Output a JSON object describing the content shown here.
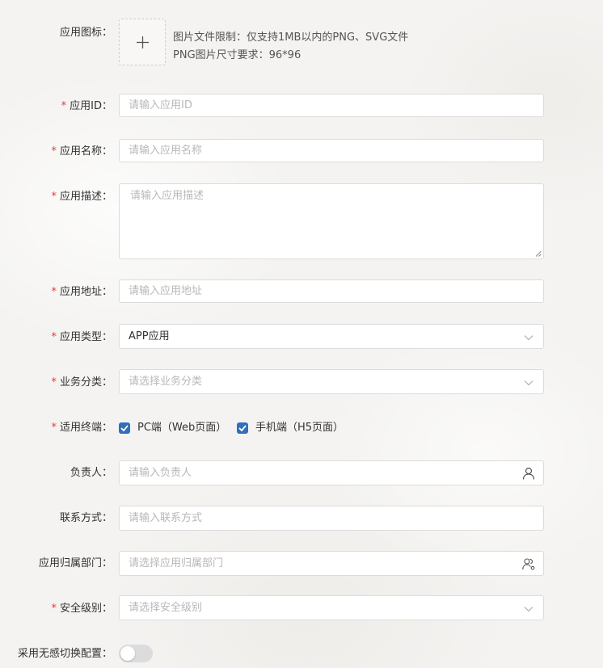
{
  "form": {
    "icon": {
      "label": "应用图标：",
      "hint_line1": "图片文件限制：仅支持1MB以内的PNG、SVG文件",
      "hint_line2": "PNG图片尺寸要求：96*96"
    },
    "app_id": {
      "required": true,
      "label": "应用ID：",
      "placeholder": "请输入应用ID"
    },
    "app_name": {
      "required": true,
      "label": "应用名称：",
      "placeholder": "请输入应用名称"
    },
    "app_desc": {
      "required": true,
      "label": "应用描述：",
      "placeholder": "请输入应用描述"
    },
    "app_url": {
      "required": true,
      "label": "应用地址：",
      "placeholder": "请输入应用地址"
    },
    "app_type": {
      "required": true,
      "label": "应用类型：",
      "value": "APP应用"
    },
    "biz_category": {
      "required": true,
      "label": "业务分类：",
      "placeholder": "请选择业务分类"
    },
    "terminals": {
      "required": true,
      "label": "适用终端：",
      "options": [
        {
          "label": "PC端（Web页面）",
          "checked": true
        },
        {
          "label": "手机端（H5页面）",
          "checked": true
        }
      ]
    },
    "owner": {
      "label": "负责人：",
      "placeholder": "请输入负责人"
    },
    "contact": {
      "label": "联系方式：",
      "placeholder": "请输入联系方式"
    },
    "department": {
      "label": "应用归属部门：",
      "placeholder": "请选择应用归属部门"
    },
    "security_level": {
      "required": true,
      "label": "安全级别：",
      "placeholder": "请选择安全级别"
    },
    "seamless_switch": {
      "label": "采用无感切换配置：",
      "enabled": false
    }
  },
  "required_mark": "*",
  "colors": {
    "required": "#e53935",
    "checkbox": "#2f6fbf",
    "border": "#dcdcdc",
    "placeholder": "#b8b8b8"
  }
}
